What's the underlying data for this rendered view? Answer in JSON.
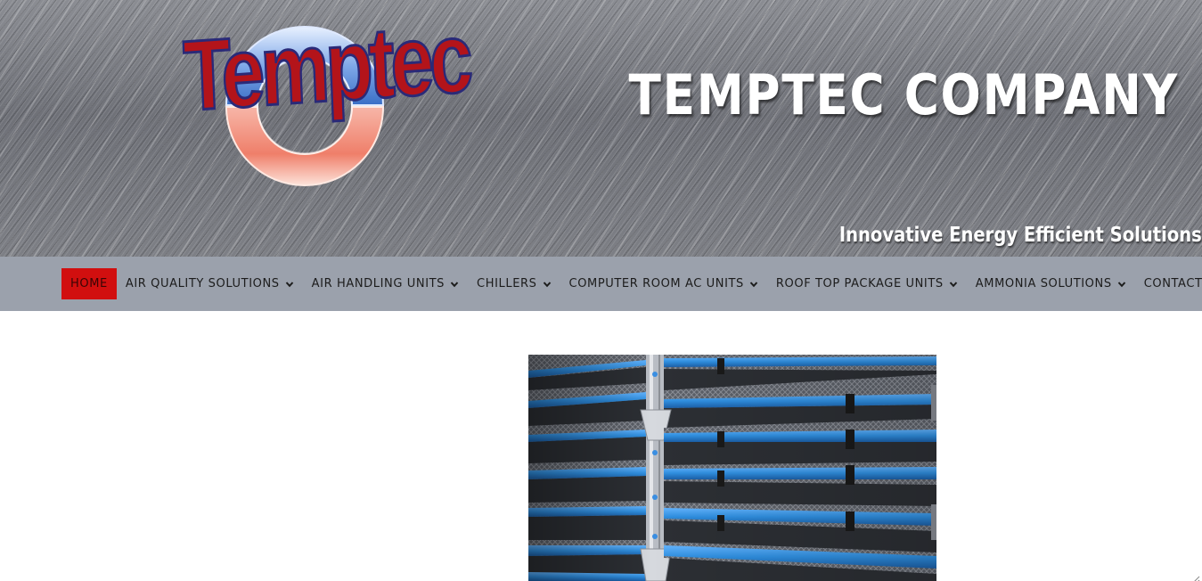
{
  "banner": {
    "logo_text": "Temptec",
    "company_title": "TEMPTEC COMPANY",
    "tagline": "Innovative Energy Efficient Solutions"
  },
  "nav": {
    "items": [
      {
        "label": "HOME",
        "active": true,
        "dropdown": false
      },
      {
        "label": "AIR QUALITY SOLUTIONS",
        "active": false,
        "dropdown": true
      },
      {
        "label": "AIR HANDLING UNITS",
        "active": false,
        "dropdown": true
      },
      {
        "label": "CHILLERS",
        "active": false,
        "dropdown": true
      },
      {
        "label": "COMPUTER ROOM AC UNITS",
        "active": false,
        "dropdown": true
      },
      {
        "label": "ROOF TOP PACKAGE UNITS",
        "active": false,
        "dropdown": true
      },
      {
        "label": "AMMONIA SOLUTIONS",
        "active": false,
        "dropdown": true
      },
      {
        "label": "CONTACT US",
        "active": false,
        "dropdown": false
      }
    ]
  },
  "icons": {
    "dropdown": "chevron-down-icon",
    "resize": "resize-grip-icon"
  },
  "colors": {
    "nav_background": "#9ba1ac",
    "nav_active": "#d10f0f",
    "logo_red": "#b3141a",
    "logo_outline": "#2a2a78",
    "filter_blue": "#2f8fe0"
  }
}
